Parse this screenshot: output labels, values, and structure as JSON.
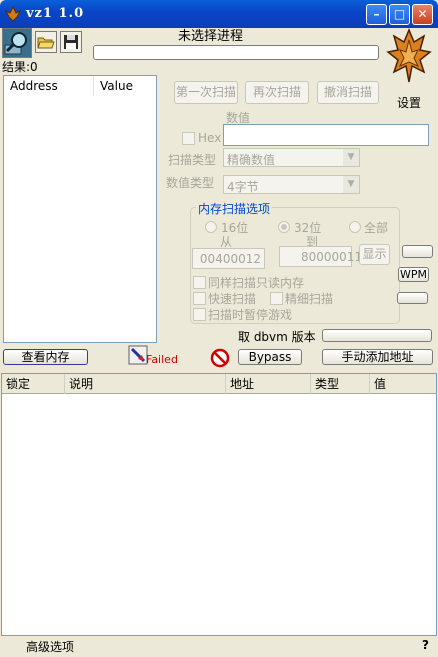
{
  "window": {
    "title": "vz1 1.0",
    "minimize_label": "–",
    "maximize_label": "□",
    "close_label": "✕"
  },
  "process": {
    "label": "未选择进程"
  },
  "results": {
    "label": "结果:0"
  },
  "list": {
    "columns": [
      "Address",
      "Value"
    ]
  },
  "scan_buttons": {
    "first": "第一次扫描",
    "next": "再次扫描",
    "undo": "撤消扫描"
  },
  "settings": {
    "label": "设置"
  },
  "value": {
    "label": "数值",
    "hex_label": "Hex"
  },
  "scan_type": {
    "label": "扫描类型",
    "selected": "精确数值"
  },
  "value_type": {
    "label": "数值类型",
    "selected": "4字节"
  },
  "memory_options": {
    "title": "内存扫描选项",
    "radio_16": "16位",
    "radio_32": "32位",
    "radio_all": "全部",
    "from_label": "从",
    "to_label": "到",
    "from_value": "00400012",
    "to_value": "80000011",
    "show_label": "显示",
    "readonly_label": "同样扫描只读内存",
    "fast_label": "快速扫描",
    "fine_label": "精细扫描",
    "pause_label": "扫描时暂停游戏"
  },
  "wpm": {
    "label": "WPM"
  },
  "dbvm": {
    "label": "取 dbvm 版本"
  },
  "toolbar": {
    "view_memory": "查看内存",
    "failed": "Failed",
    "bypass": "Bypass",
    "add_address": "手动添加地址"
  },
  "address_table": {
    "columns": [
      "锁定",
      "说明",
      "地址",
      "类型",
      "值"
    ]
  },
  "footer": {
    "advanced": "高级选项",
    "help": "?"
  }
}
